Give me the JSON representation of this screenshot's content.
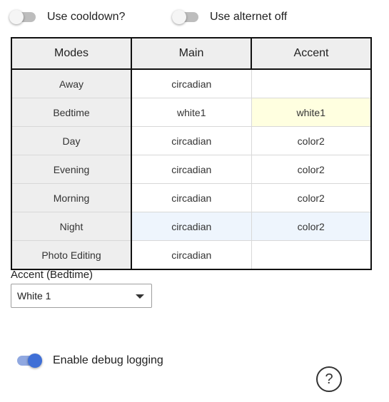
{
  "toggles": {
    "cooldown": {
      "label": "Use cooldown?",
      "on": false
    },
    "alternet": {
      "label": "Use alternet off",
      "on": false
    },
    "debug": {
      "label": "Enable debug logging",
      "on": true
    }
  },
  "table": {
    "headers": [
      "Modes",
      "Main",
      "Accent"
    ],
    "rows": [
      {
        "mode": "Away",
        "main": "circadian",
        "accent": ""
      },
      {
        "mode": "Bedtime",
        "main": "white1",
        "accent": "white1"
      },
      {
        "mode": "Day",
        "main": "circadian",
        "accent": "color2"
      },
      {
        "mode": "Evening",
        "main": "circadian",
        "accent": "color2"
      },
      {
        "mode": "Morning",
        "main": "circadian",
        "accent": "color2"
      },
      {
        "mode": "Night",
        "main": "circadian",
        "accent": "color2"
      },
      {
        "mode": "Photo Editing",
        "main": "circadian",
        "accent": ""
      }
    ]
  },
  "accent_select": {
    "label": "Accent (Bedtime)",
    "value": "White 1"
  },
  "help": {
    "symbol": "?"
  },
  "colors": {
    "toggle_on": "#3f6fd6",
    "toggle_on_track": "#90a8e0",
    "selected_cell": "#ffffe0",
    "hover_row": "#eef5fd"
  }
}
